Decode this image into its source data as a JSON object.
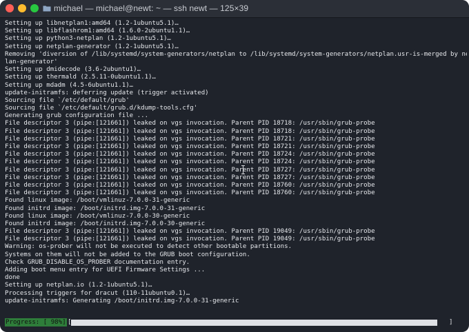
{
  "window": {
    "title": "michael — michael@newt: ~ — ssh newt — 125×39"
  },
  "terminal": {
    "lines": [
      "Setting up libnetplan1:amd64 (1.2-1ubuntu5.1)…",
      "Setting up libflashrom1:amd64 (1.6.0-2ubuntu1.1)…",
      "Setting up python3-netplan (1.2-1ubuntu5.1)…",
      "Setting up netplan-generator (1.2-1ubuntu5.1)…",
      "Removing 'diversion of /lib/systemd/system-generators/netplan to /lib/systemd/system-generators/netplan.usr-is-merged by netp",
      "lan-generator'",
      "Setting up dmidecode (3.6-2ubuntu1)…",
      "Setting up thermald (2.5.11-0ubuntu1.1)…",
      "Setting up mdadm (4.5-6ubuntu1.1)…",
      "update-initramfs: deferring update (trigger activated)",
      "Sourcing file `/etc/default/grub'",
      "Sourcing file `/etc/default/grub.d/kdump-tools.cfg'",
      "Generating grub configuration file ...",
      "File descriptor 3 (pipe:[121661]) leaked on vgs invocation. Parent PID 18718: /usr/sbin/grub-probe",
      "File descriptor 3 (pipe:[121661]) leaked on vgs invocation. Parent PID 18718: /usr/sbin/grub-probe",
      "File descriptor 3 (pipe:[121661]) leaked on vgs invocation. Parent PID 18721: /usr/sbin/grub-probe",
      "File descriptor 3 (pipe:[121661]) leaked on vgs invocation. Parent PID 18721: /usr/sbin/grub-probe",
      "File descriptor 3 (pipe:[121661]) leaked on vgs invocation. Parent PID 18724: /usr/sbin/grub-probe",
      "File descriptor 3 (pipe:[121661]) leaked on vgs invocation. Parent PID 18724: /usr/sbin/grub-probe",
      "File descriptor 3 (pipe:[121661]) leaked on vgs invocation. Parent PID 18727: /usr/sbin/grub-probe",
      "File descriptor 3 (pipe:[121661]) leaked on vgs invocation. Parent PID 18727: /usr/sbin/grub-probe",
      "File descriptor 3 (pipe:[121661]) leaked on vgs invocation. Parent PID 18760: /usr/sbin/grub-probe",
      "File descriptor 3 (pipe:[121661]) leaked on vgs invocation. Parent PID 18760: /usr/sbin/grub-probe",
      "Found linux image: /boot/vmlinuz-7.0.0-31-generic",
      "Found initrd image: /boot/initrd.img-7.0.0-31-generic",
      "Found linux image: /boot/vmlinuz-7.0.0-30-generic",
      "Found initrd image: /boot/initrd.img-7.0.0-30-generic",
      "File descriptor 3 (pipe:[121661]) leaked on vgs invocation. Parent PID 19049: /usr/sbin/grub-probe",
      "File descriptor 3 (pipe:[121661]) leaked on vgs invocation. Parent PID 19049: /usr/sbin/grub-probe",
      "Warning: os-prober will not be executed to detect other bootable partitions.",
      "Systems on them will not be added to the GRUB boot configuration.",
      "Check GRUB_DISABLE_OS_PROBER documentation entry.",
      "Adding boot menu entry for UEFI Firmware Settings ...",
      "done",
      "Setting up netplan.io (1.2-1ubuntu5.1)…",
      "Processing triggers for dracut (110-11ubuntu0.1)…",
      "update-initramfs: Generating /boot/initrd.img-7.0.0-31-generic"
    ]
  },
  "progress": {
    "label": "Progress: [ 98%]",
    "open_bracket": "[",
    "close_bracket": "]",
    "fraction": 0.98
  },
  "colors": {
    "progress_label_bg": "#2e7d3a",
    "terminal_bg": "#1f232b"
  },
  "icons": {
    "title_icon": "folder-icon",
    "pointer": "i-beam-cursor-icon"
  }
}
